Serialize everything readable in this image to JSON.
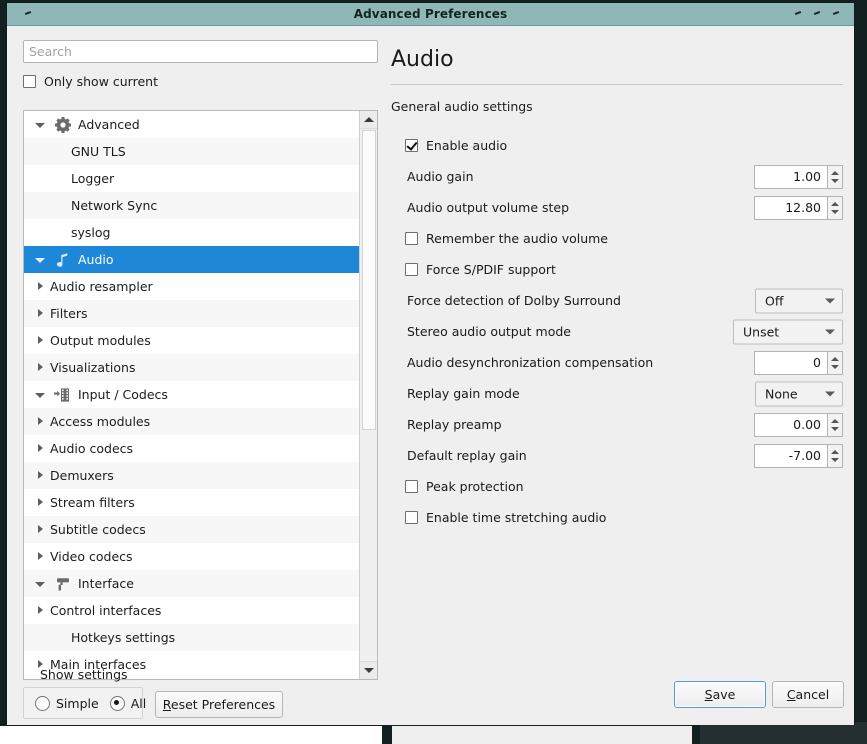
{
  "window": {
    "title": "Advanced Preferences",
    "controls": [
      "minimize-mark",
      "maximize-mark",
      "close-mark"
    ]
  },
  "sidebar": {
    "search": {
      "placeholder": "Search",
      "value": ""
    },
    "only_show_current": {
      "label": "Only show current",
      "checked": false
    },
    "tree": [
      {
        "label": "Advanced",
        "icon": "gear-icon",
        "level": 0,
        "twisty": "open",
        "selected": false
      },
      {
        "label": "GNU TLS",
        "icon": "",
        "level": 1,
        "twisty": "none",
        "selected": false
      },
      {
        "label": "Logger",
        "icon": "",
        "level": 1,
        "twisty": "none",
        "selected": false
      },
      {
        "label": "Network Sync",
        "icon": "",
        "level": 1,
        "twisty": "none",
        "selected": false
      },
      {
        "label": "syslog",
        "icon": "",
        "level": 1,
        "twisty": "none",
        "selected": false
      },
      {
        "label": "Audio",
        "icon": "music-note-icon",
        "level": 0,
        "twisty": "open",
        "selected": true
      },
      {
        "label": "Audio resampler",
        "icon": "",
        "level": 2,
        "twisty": "closed",
        "selected": false
      },
      {
        "label": "Filters",
        "icon": "",
        "level": 2,
        "twisty": "closed",
        "selected": false
      },
      {
        "label": "Output modules",
        "icon": "",
        "level": 2,
        "twisty": "closed",
        "selected": false
      },
      {
        "label": "Visualizations",
        "icon": "",
        "level": 2,
        "twisty": "closed",
        "selected": false
      },
      {
        "label": "Input / Codecs",
        "icon": "film-strip-icon",
        "level": 0,
        "twisty": "open",
        "selected": false
      },
      {
        "label": "Access modules",
        "icon": "",
        "level": 2,
        "twisty": "closed",
        "selected": false
      },
      {
        "label": "Audio codecs",
        "icon": "",
        "level": 2,
        "twisty": "closed",
        "selected": false
      },
      {
        "label": "Demuxers",
        "icon": "",
        "level": 2,
        "twisty": "closed",
        "selected": false
      },
      {
        "label": "Stream filters",
        "icon": "",
        "level": 2,
        "twisty": "closed",
        "selected": false
      },
      {
        "label": "Subtitle codecs",
        "icon": "",
        "level": 2,
        "twisty": "closed",
        "selected": false
      },
      {
        "label": "Video codecs",
        "icon": "",
        "level": 2,
        "twisty": "closed",
        "selected": false
      },
      {
        "label": "Interface",
        "icon": "paint-roller-icon",
        "level": 0,
        "twisty": "open",
        "selected": false
      },
      {
        "label": "Control interfaces",
        "icon": "",
        "level": 2,
        "twisty": "closed",
        "selected": false
      },
      {
        "label": "Hotkeys settings",
        "icon": "",
        "level": 1,
        "twisty": "none",
        "selected": false
      },
      {
        "label": "Main interfaces",
        "icon": "",
        "level": 2,
        "twisty": "closed",
        "selected": false
      }
    ]
  },
  "main": {
    "title": "Audio",
    "description": "General audio settings",
    "settings": [
      {
        "type": "checkbox",
        "label": "Enable audio",
        "checked": true
      },
      {
        "type": "spin",
        "label": "Audio gain",
        "value": "1.00"
      },
      {
        "type": "spin",
        "label": "Audio output volume step",
        "value": "12.80"
      },
      {
        "type": "checkbox",
        "label": "Remember the audio volume",
        "checked": false
      },
      {
        "type": "checkbox",
        "label": "Force S/PDIF support",
        "checked": false
      },
      {
        "type": "combo",
        "label": "Force detection of Dolby Surround",
        "value": "Off"
      },
      {
        "type": "combo",
        "label": "Stereo audio output mode",
        "value": "Unset",
        "wide": true
      },
      {
        "type": "spin",
        "label": "Audio desynchronization compensation",
        "value": "0"
      },
      {
        "type": "combo",
        "label": "Replay gain mode",
        "value": "None"
      },
      {
        "type": "spin",
        "label": "Replay preamp",
        "value": "0.00"
      },
      {
        "type": "spin",
        "label": "Default replay gain",
        "value": "-7.00"
      },
      {
        "type": "checkbox",
        "label": "Peak protection",
        "checked": false
      },
      {
        "type": "checkbox",
        "label": "Enable time stretching audio",
        "checked": false
      }
    ]
  },
  "footer": {
    "show_settings_label": "Show settings",
    "mode_simple": {
      "label": "Simple",
      "selected": false
    },
    "mode_all": {
      "label": "All",
      "selected": true
    },
    "reset_button": {
      "accel": "R",
      "rest": "eset Preferences"
    },
    "save_button": {
      "accel": "S",
      "rest": "ave"
    },
    "cancel_button": {
      "accel": "C",
      "rest": "ancel"
    }
  },
  "colors": {
    "titlebar": "#8fb7b7",
    "selection": "#1f87d8",
    "window_bg": "#efefef",
    "focus_border": "#5b9bd5"
  }
}
